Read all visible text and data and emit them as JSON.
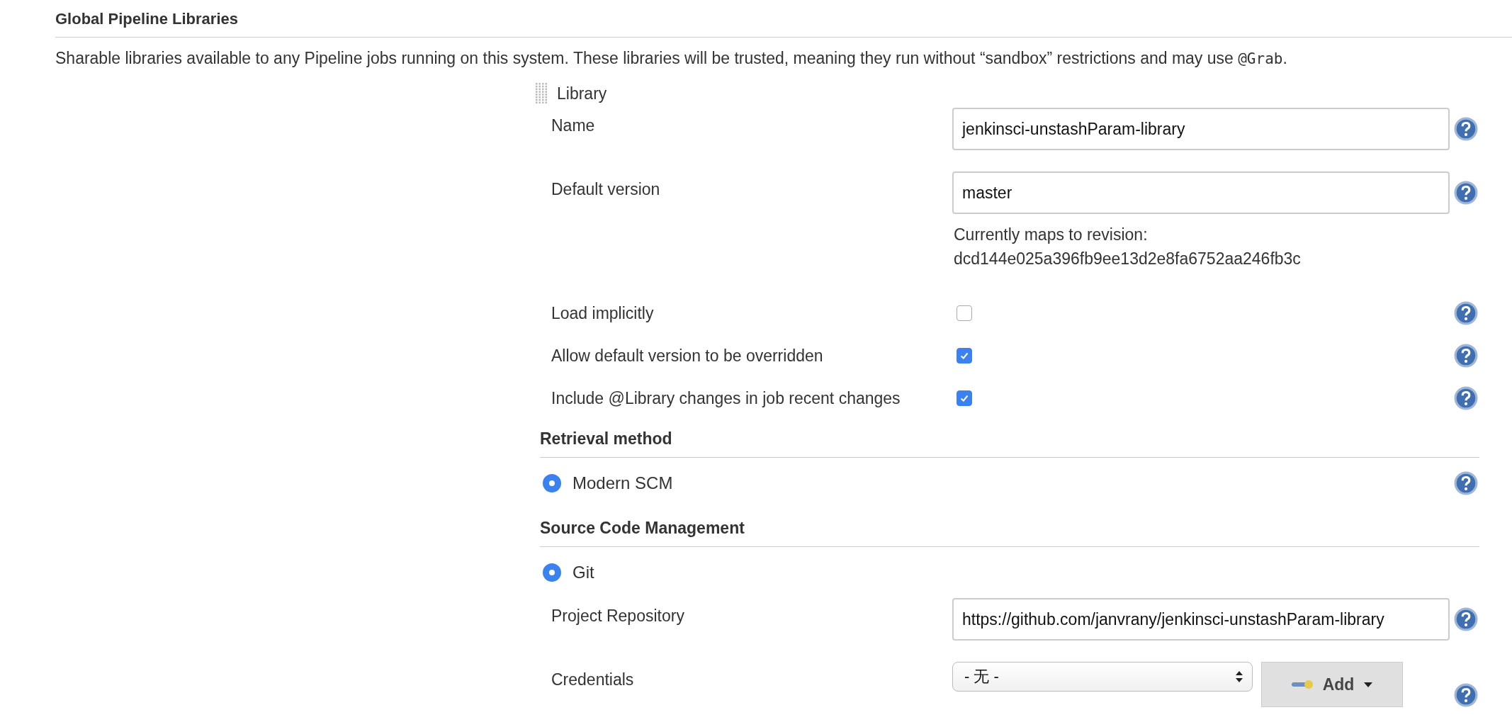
{
  "section": {
    "title": "Global Pipeline Libraries",
    "description": {
      "text": "Sharable libraries available to any Pipeline jobs running on this system. These libraries will be trusted, meaning they run without “sandbox” restrictions and may use ",
      "code": "@Grab",
      "end": "."
    }
  },
  "library": {
    "title": "Library",
    "fields": [
      {
        "kind": "text",
        "label": "Name",
        "value": "jenkinsci-unstashParam-library"
      },
      {
        "kind": "text",
        "label": "Default version",
        "value": "master",
        "notes": [
          "Currently maps to revision:",
          "dcd144e025a396fb9ee13d2e8fa6752aa246fb3c"
        ]
      },
      {
        "kind": "checkbox",
        "label": "Load implicitly",
        "checked": false
      },
      {
        "kind": "checkbox",
        "label": "Allow default version to be overridden",
        "checked": true
      },
      {
        "kind": "checkbox",
        "label": "Include @Library changes in job recent changes",
        "checked": true
      }
    ]
  },
  "retrieval": {
    "title": "Retrieval method",
    "options": [
      {
        "label": "Modern SCM",
        "selected": true
      }
    ]
  },
  "scm": {
    "title": "Source Code Management",
    "options": [
      {
        "label": "Git",
        "selected": true
      }
    ],
    "fields": [
      {
        "kind": "text",
        "label": "Project Repository",
        "value": "https://github.com/janvrany/jenkinsci-unstashParam-library"
      },
      {
        "kind": "select",
        "label": "Credentials",
        "value": "- 无 -",
        "button": "Add"
      }
    ]
  }
}
